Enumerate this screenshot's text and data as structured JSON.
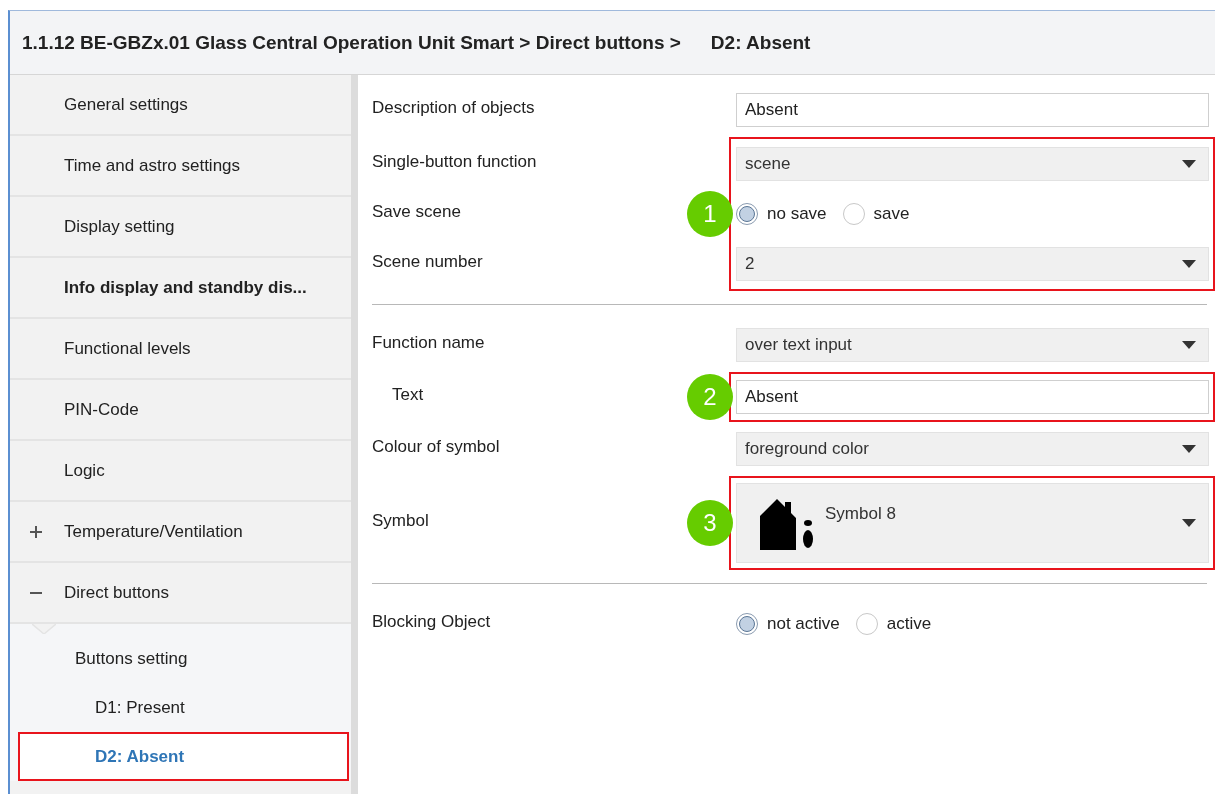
{
  "header": {
    "path": "1.1.12 BE-GBZx.01 Glass Central Operation Unit Smart > Direct buttons >",
    "current": "D2: Absent"
  },
  "sidebar": {
    "items": [
      {
        "label": "General settings",
        "bold": false,
        "selected": false
      },
      {
        "label": "Time and astro settings",
        "bold": false,
        "selected": false
      },
      {
        "label": "Display setting",
        "bold": false,
        "selected": false
      },
      {
        "label": "Info display and standby dis...",
        "bold": true,
        "selected": false
      },
      {
        "label": "Functional levels",
        "bold": false,
        "selected": false
      },
      {
        "label": "PIN-Code",
        "bold": false,
        "selected": false
      },
      {
        "label": "Logic",
        "bold": false,
        "selected": false
      },
      {
        "label": "Temperature/Ventilation",
        "bold": false,
        "selected": false,
        "expanded": false
      },
      {
        "label": "Direct buttons",
        "bold": false,
        "selected": false,
        "expanded": true,
        "children": [
          {
            "label": "Buttons setting",
            "selected": false,
            "children": [
              {
                "label": "D1: Present",
                "selected": false
              },
              {
                "label": "D2: Absent",
                "selected": true
              }
            ]
          }
        ]
      }
    ]
  },
  "sections": [
    {
      "blocks": [
        {
          "rows": [
            {
              "kind": "input",
              "label": "Description of objects",
              "indented": false,
              "value": "Absent"
            }
          ]
        },
        {
          "callout": "1",
          "rows": [
            {
              "kind": "select",
              "label": "Single-button function",
              "indented": false,
              "value": "scene"
            },
            {
              "kind": "radio",
              "label": "Save scene",
              "indented": false,
              "options": [
                {
                  "label": "no save",
                  "selected": true
                },
                {
                  "label": "save",
                  "selected": false
                }
              ]
            },
            {
              "kind": "select",
              "label": "Scene number",
              "indented": false,
              "value": "2"
            }
          ]
        }
      ]
    },
    {
      "blocks": [
        {
          "rows": [
            {
              "kind": "select",
              "label": "Function name",
              "indented": false,
              "value": "over text input"
            }
          ]
        },
        {
          "callout": "2",
          "rows": [
            {
              "kind": "input",
              "label": "Text",
              "indented": true,
              "value": "Absent"
            }
          ]
        },
        {
          "rows": [
            {
              "kind": "select",
              "label": "Colour of symbol",
              "indented": false,
              "value": "foreground color"
            }
          ]
        },
        {
          "callout": "3",
          "rows": [
            {
              "kind": "symbol-select",
              "label": "Symbol",
              "indented": false,
              "value": "Symbol 8"
            }
          ]
        }
      ]
    },
    {
      "blocks": [
        {
          "rows": [
            {
              "kind": "radio",
              "label": "Blocking Object",
              "indented": false,
              "options": [
                {
                  "label": "not active",
                  "selected": true
                },
                {
                  "label": "active",
                  "selected": false
                }
              ]
            }
          ]
        }
      ]
    }
  ]
}
